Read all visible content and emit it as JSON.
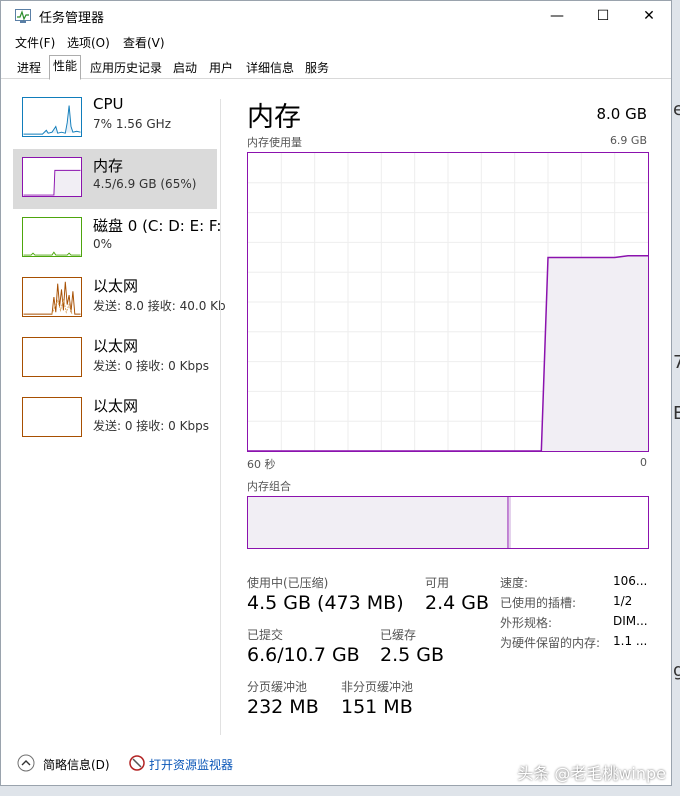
{
  "window": {
    "title": "任务管理器",
    "minimize": "—",
    "maximize": "☐",
    "close": "✕"
  },
  "menu": [
    "文件(F)",
    "选项(O)",
    "查看(V)"
  ],
  "tabs": [
    "进程",
    "性能",
    "应用历史记录",
    "启动",
    "用户",
    "详细信息",
    "服务"
  ],
  "active_tab": "性能",
  "sidebar": [
    {
      "title": "CPU",
      "sub": "7% 1.56 GHz",
      "color": "#117dbb"
    },
    {
      "title": "内存",
      "sub": "4.5/6.9 GB (65%)",
      "color": "#8b12ae"
    },
    {
      "title": "磁盘 0 (C: D: E: F:",
      "sub": "0%",
      "color": "#4da60c"
    },
    {
      "title": "以太网",
      "sub": "发送: 8.0 接收: 40.0 Kb",
      "color": "#a74f01"
    },
    {
      "title": "以太网",
      "sub": "发送: 0 接收: 0 Kbps",
      "color": "#a74f01"
    },
    {
      "title": "以太网",
      "sub": "发送: 0 接收: 0 Kbps",
      "color": "#a74f01"
    }
  ],
  "main": {
    "title": "内存",
    "total": "8.0 GB",
    "usage_label": "内存使用量",
    "usage_max": "6.9 GB",
    "axis_left": "60 秒",
    "axis_right": "0",
    "composition_label": "内存组合",
    "accent": "#8b12ae",
    "fill": "#f1eef4",
    "usage_series": [
      0,
      0,
      0,
      0,
      0,
      0,
      0,
      0,
      0,
      0,
      0,
      0,
      0,
      0,
      0,
      0,
      0,
      0,
      0,
      0,
      0,
      0,
      0,
      0,
      0,
      0,
      0,
      0,
      0,
      0,
      0,
      0,
      0,
      0,
      0,
      0,
      0,
      0,
      0,
      0,
      0,
      0,
      0,
      0,
      0,
      4.48,
      4.48,
      4.48,
      4.48,
      4.48,
      4.48,
      4.48,
      4.48,
      4.48,
      4.48,
      4.48,
      4.5,
      4.52,
      4.52,
      4.52,
      4.52
    ],
    "composition": {
      "in_use_fraction": 0.65,
      "modified_fraction": 0.005
    }
  },
  "stats": {
    "in_use_label": "使用中(已压缩)",
    "in_use": "4.5 GB (473 MB)",
    "available_label": "可用",
    "available": "2.4 GB",
    "committed_label": "已提交",
    "committed": "6.6/10.7 GB",
    "cached_label": "已缓存",
    "cached": "2.5 GB",
    "paged_label": "分页缓冲池",
    "paged": "232 MB",
    "nonpaged_label": "非分页缓冲池",
    "nonpaged": "151 MB"
  },
  "details": [
    {
      "label": "速度:",
      "value": "106..."
    },
    {
      "label": "已使用的插槽:",
      "value": "1/2"
    },
    {
      "label": "外形规格:",
      "value": "DIM..."
    },
    {
      "label": "为硬件保留的内存:",
      "value": "1.1 ..."
    }
  ],
  "footer": {
    "brief": "简略信息(D)",
    "monitor": "打开资源监视器"
  },
  "watermark": "头条 @老毛桃winpe",
  "edge_chars": [
    "e",
    "7",
    "E",
    "g"
  ]
}
